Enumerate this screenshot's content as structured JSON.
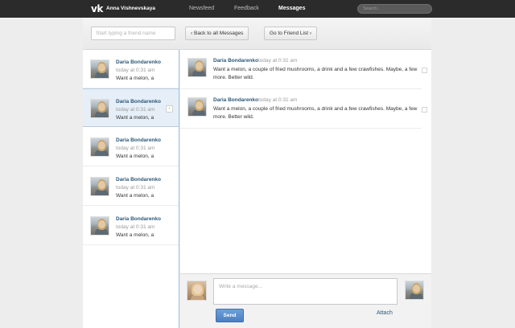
{
  "header": {
    "logo": "vk",
    "username": "Anna Vishnevskaya",
    "nav": [
      "Newsfeed",
      "Feedback",
      "Messages"
    ],
    "active_nav": "Messages",
    "search_placeholder": "Search..."
  },
  "toolbar": {
    "friend_search_placeholder": "Start typing a friend name",
    "back_label": "Back to all Messages",
    "friend_list_label": "Go to Friend List"
  },
  "conversations": [
    {
      "name": "Daria Bondarenko",
      "time": "today at 0:31 am",
      "preview": "Want a melon, a",
      "selected": false
    },
    {
      "name": "Daria Bondarenko",
      "time": "today at 0:31 am",
      "preview": "Want a melon, a",
      "selected": true
    },
    {
      "name": "Daria Bondarenko",
      "time": "today at 0:31 am",
      "preview": "Want a melon, a",
      "selected": false
    },
    {
      "name": "Daria Bondarenko",
      "time": "today at 0:31 am",
      "preview": "Want a melon, a",
      "selected": false
    },
    {
      "name": "Daria Bondarenko",
      "time": "today at 0:31 am",
      "preview": "Want a melon, a",
      "selected": false
    }
  ],
  "messages": [
    {
      "name": "Daria Bondarenko",
      "time": "today at 0:31 am",
      "text": "Want a melon, a couple of fried mushrooms, a drink and a few crawfishes. Maybe, a few more. Better wild."
    },
    {
      "name": "Daria Bondarenko",
      "time": "today at 0:31 am",
      "text": "Want a melon, a couple of fried mushrooms, a drink and a few crawfishes. Maybe, a few more. Better wild."
    }
  ],
  "compose": {
    "placeholder": "Write a message...",
    "send_label": "Send",
    "attach_label": "Attach"
  },
  "colors": {
    "topbar": "#2b2b2b",
    "link": "#2b587a",
    "send_button": "#5a8dcc",
    "selected_row": "#e6eef7"
  }
}
